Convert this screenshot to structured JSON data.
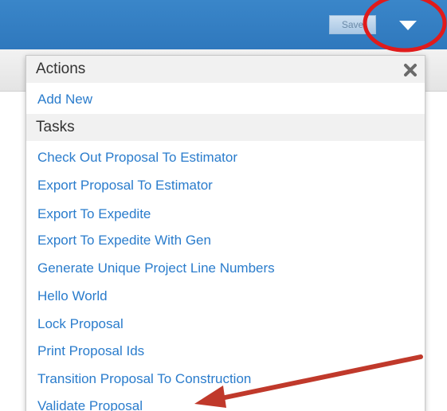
{
  "toolbar": {
    "save_label": "Save"
  },
  "menu": {
    "actions_header": "Actions",
    "actions": [
      "Add New"
    ],
    "tasks_header": "Tasks",
    "tasks": [
      "Check Out Proposal To Estimator",
      "Export Proposal To Estimator",
      "Export To Expedite",
      "Export To Expedite With Gen",
      "Generate Unique Project Line Numbers",
      "Hello World",
      "Lock Proposal",
      "Print Proposal Ids",
      "Transition Proposal To Construction",
      "Validate Proposal"
    ]
  },
  "colors": {
    "topbar": "#3a86c9",
    "link": "#2a7ccc",
    "annotation_circle": "#e01b1b",
    "annotation_arrow": "#c0392b"
  }
}
